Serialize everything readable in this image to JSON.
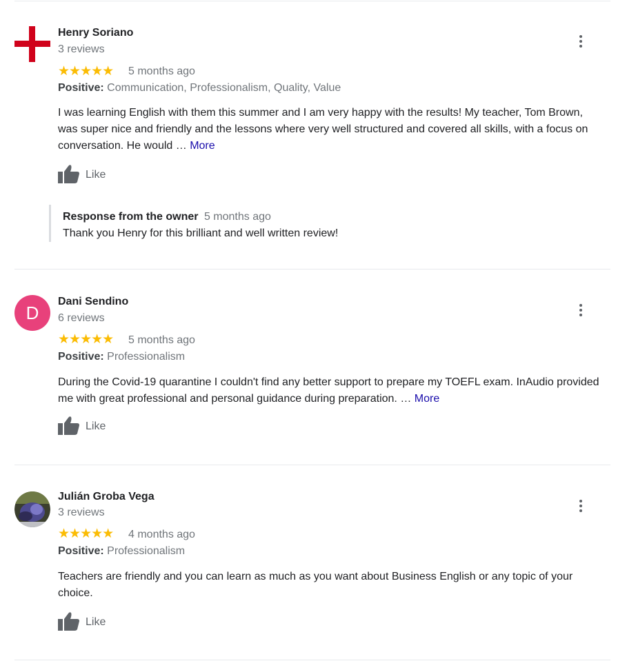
{
  "reviews": [
    {
      "name": "Henry Soriano",
      "count": "3 reviews",
      "stars": "★★★★★",
      "rating": 5,
      "date": "5 months ago",
      "positive_label": "Positive:",
      "positive_values": "Communication, Professionalism, Quality, Value",
      "text": "I was learning English with them this summer and I am very happy with the results! My teacher, Tom Brown, was super nice and friendly and the lessons where very well structured and covered all skills, with a focus on conversation. He would … ",
      "more": "More",
      "like": "Like",
      "owner_response": {
        "title": "Response from the owner",
        "date": "5 months ago",
        "text": "Thank you Henry for this brilliant and well written review!"
      }
    },
    {
      "name": "Dani Sendino",
      "avatar_letter": "D",
      "avatar_color": "#e8417b",
      "count": "6 reviews",
      "stars": "★★★★★",
      "rating": 5,
      "date": "5 months ago",
      "positive_label": "Positive:",
      "positive_values": "Professionalism",
      "text": "During the Covid-19 quarantine I couldn't find any better support to prepare my TOEFL exam. InAudio provided me with great professional and personal guidance during preparation. … ",
      "more": "More",
      "like": "Like"
    },
    {
      "name": "Julián Groba Vega",
      "count": "3 reviews",
      "stars": "★★★★★",
      "rating": 5,
      "date": "4 months ago",
      "positive_label": "Positive:",
      "positive_values": "Professionalism",
      "text": "Teachers are friendly and you can learn as much as you want about Business English or any topic of your choice.",
      "like": "Like"
    }
  ],
  "colors": {
    "star": "#fbbc04",
    "link": "#1a0dab",
    "muted": "#70757a",
    "cross": "#d0021b"
  }
}
